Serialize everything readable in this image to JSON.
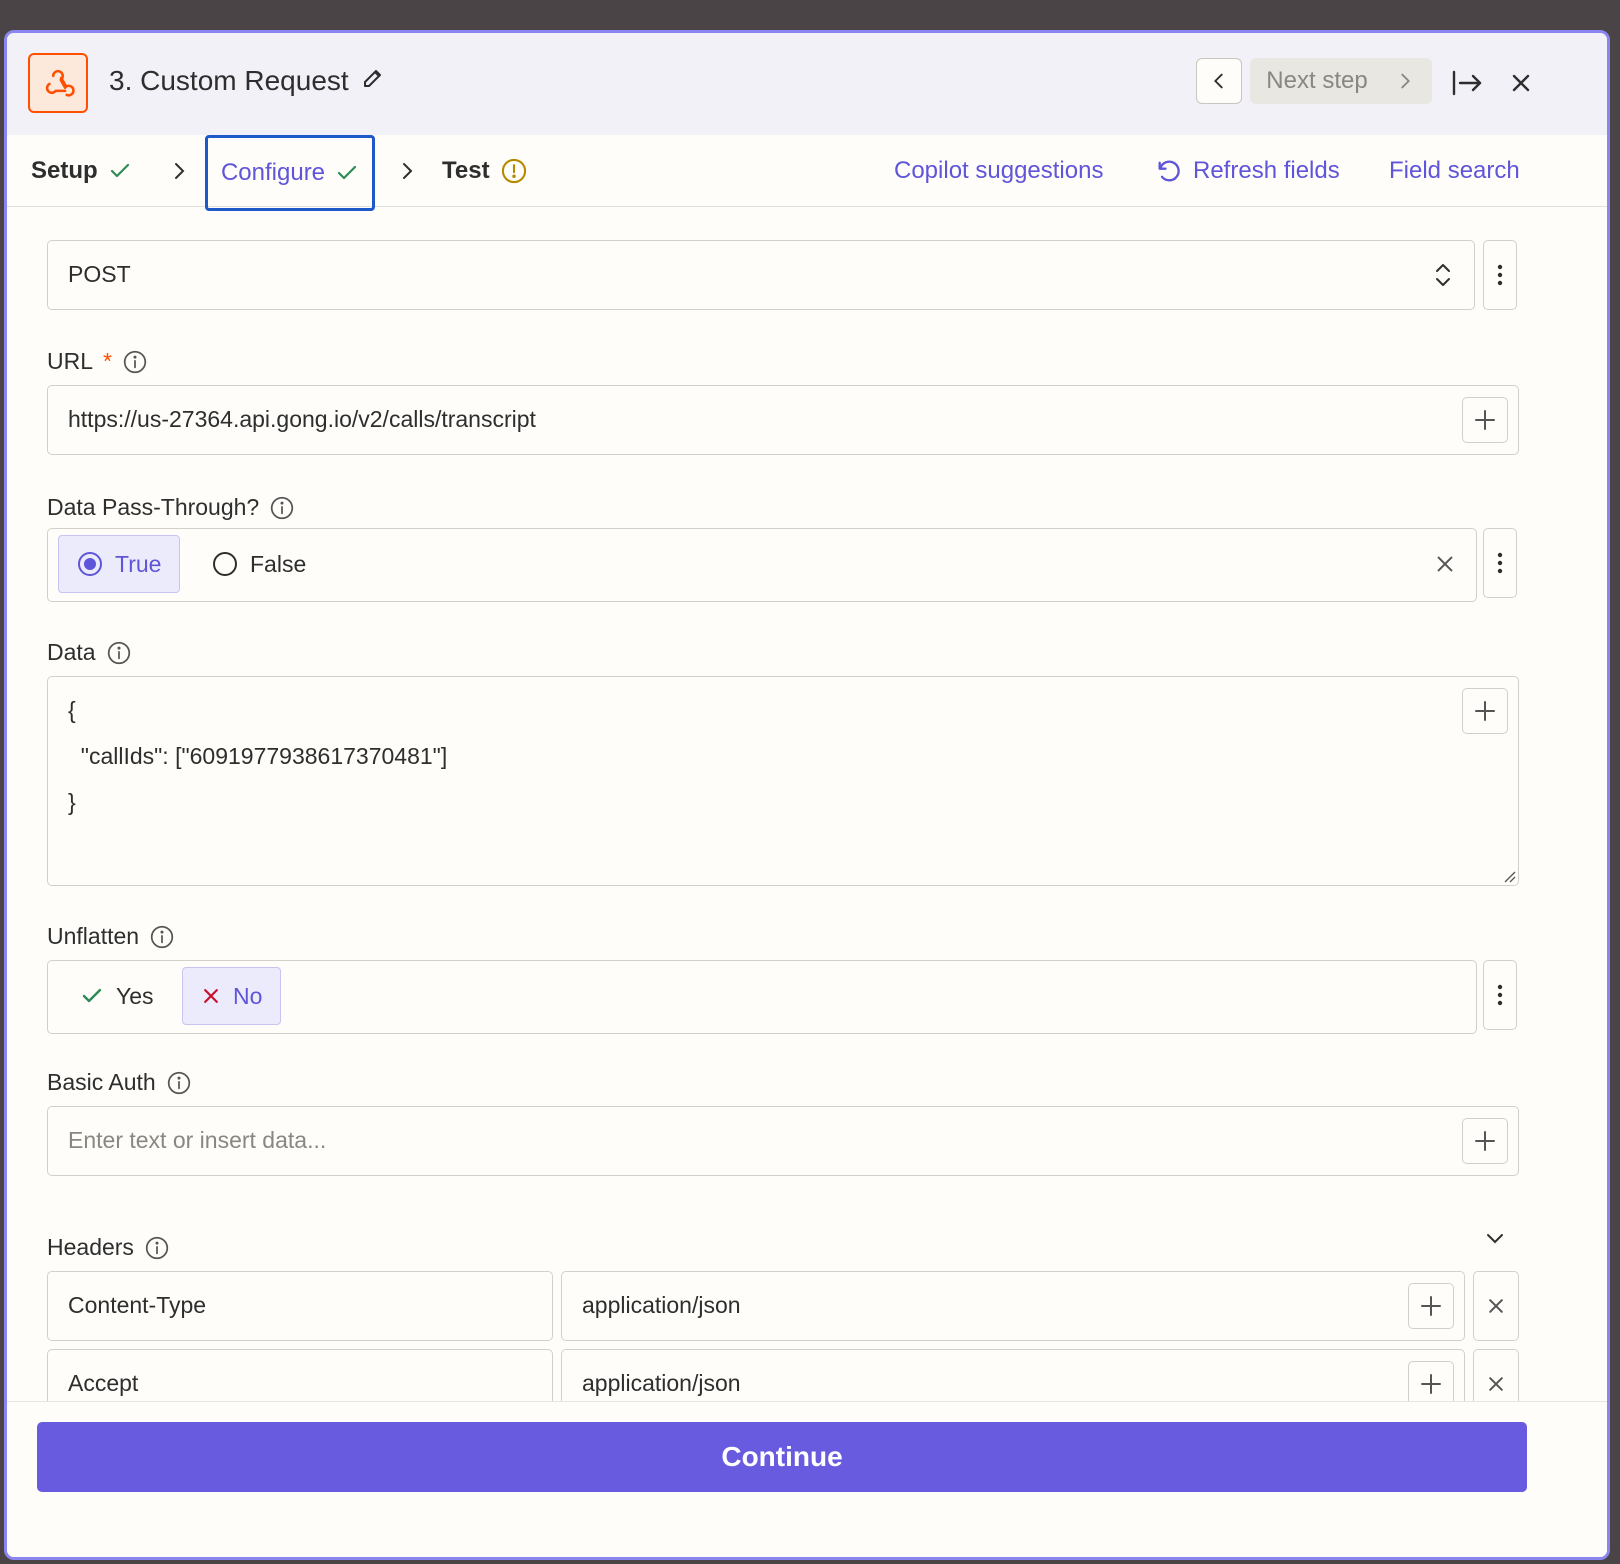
{
  "header": {
    "title": "3. Custom Request",
    "next_step_label": "Next step"
  },
  "tabs": {
    "setup": "Setup",
    "configure": "Configure",
    "test": "Test"
  },
  "actions": {
    "copilot": "Copilot suggestions",
    "refresh": "Refresh fields",
    "field_search": "Field search"
  },
  "method": {
    "value": "POST"
  },
  "url": {
    "label": "URL",
    "required_mark": "*",
    "value": "https://us-27364.api.gong.io/v2/calls/transcript"
  },
  "pass_through": {
    "label": "Data Pass-Through?",
    "options": [
      "True",
      "False"
    ],
    "selected": "True"
  },
  "data_field": {
    "label": "Data",
    "lines": [
      "{",
      "  \"callIds\": [\"6091977938617370481\"]",
      "}"
    ]
  },
  "unflatten": {
    "label": "Unflatten",
    "yes": "Yes",
    "no": "No",
    "selected": "No"
  },
  "basic_auth": {
    "label": "Basic Auth",
    "placeholder": "Enter text or insert data..."
  },
  "headers": {
    "label": "Headers",
    "rows": [
      {
        "key": "Content-Type",
        "value": "application/json"
      },
      {
        "key": "Accept",
        "value": "application/json"
      }
    ]
  },
  "footer": {
    "continue_label": "Continue"
  },
  "colors": {
    "accent": "#695be0",
    "link": "#5f55d9",
    "brand_orange": "#ff4f00",
    "success_green": "#2e8b57",
    "warning": "#b58a00"
  }
}
